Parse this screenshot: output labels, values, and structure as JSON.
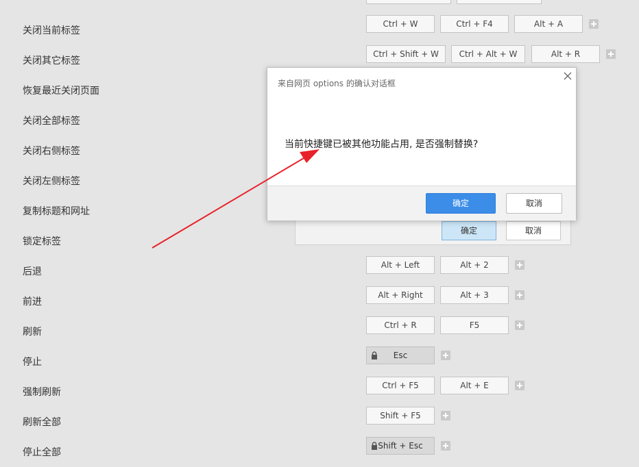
{
  "colors": {
    "background": "#e5e5e5",
    "key_background": "#f7f7f7",
    "locked_key_background": "#d9d9d9",
    "primary_button": "#3b8de8",
    "arrow": "#e8222a"
  },
  "shortcuts": [
    {
      "label": "关闭当前标签",
      "keys": [
        "Ctrl + W",
        "Ctrl + F4",
        "Alt + A"
      ]
    },
    {
      "label": "关闭其它标签",
      "keys": [
        "Ctrl + Shift + W",
        "Ctrl + Alt + W",
        "Alt + R"
      ]
    },
    {
      "label": "恢复最近关闭页面",
      "keys": []
    },
    {
      "label": "关闭全部标签",
      "keys": []
    },
    {
      "label": "关闭右侧标签",
      "keys": []
    },
    {
      "label": "关闭左侧标签",
      "keys": []
    },
    {
      "label": "复制标题和网址",
      "keys": []
    },
    {
      "label": "锁定标签",
      "keys": []
    },
    {
      "label": "后退",
      "keys": [
        "Alt + Left",
        "Alt + 2"
      ]
    },
    {
      "label": "前进",
      "keys": [
        "Alt + Right",
        "Alt + 3"
      ]
    },
    {
      "label": "刷新",
      "keys": [
        "Ctrl + R",
        "F5"
      ]
    },
    {
      "label": "停止",
      "keys": [
        "Esc"
      ],
      "locked": true
    },
    {
      "label": "强制刷新",
      "keys": [
        "Ctrl + F5",
        "Alt + E"
      ]
    },
    {
      "label": "刷新全部",
      "keys": [
        "Shift + F5"
      ]
    },
    {
      "label": "停止全部",
      "keys": [
        "Shift + Esc"
      ],
      "locked": true
    }
  ],
  "inner_dialog": {
    "ok_label": "确定",
    "cancel_label": "取消"
  },
  "dialog": {
    "title": "来自网页 options 的确认对话框",
    "message": "当前快捷键已被其他功能占用, 是否强制替换?",
    "ok_label": "确定",
    "cancel_label": "取消",
    "close_icon": "close-icon"
  },
  "annotation": {
    "icon": "red-arrow-icon"
  }
}
